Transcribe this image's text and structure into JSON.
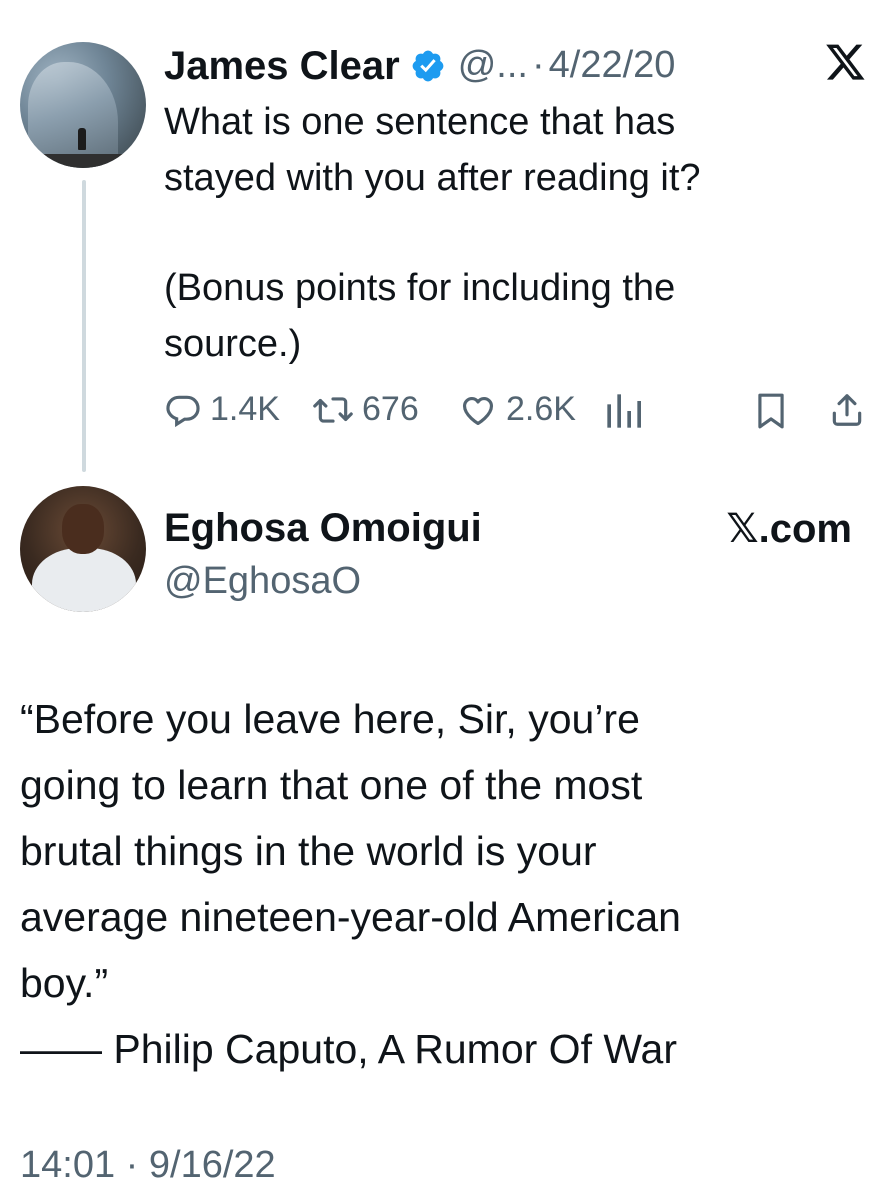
{
  "original_tweet": {
    "author_name": "James Clear",
    "handle_truncated": "@...",
    "separator": "·",
    "date": "4/22/20",
    "text_line1": "What is one sentence that has",
    "text_line2": "stayed with you after reading it?",
    "text_line3": "(Bonus points for including the",
    "text_line4": "source.)",
    "stats": {
      "replies": "1.4K",
      "retweets": "676",
      "likes": "2.6K"
    }
  },
  "reply_tweet": {
    "author_name": "Eghosa Omoigui",
    "handle": "@EghosaO",
    "source_label": "𝕏.com",
    "quote_lines": [
      "“Before you leave here, Sir, you’re",
      "going to learn that one of the most",
      "brutal things in the world is your",
      "average nineteen-year-old American",
      "boy.”",
      "—— Philip Caputo, A Rumor Of War"
    ],
    "time": "14:01",
    "separator": "·",
    "date": "9/16/22"
  },
  "icons": {
    "close": "x-logo-icon",
    "verified": "verified-badge-icon",
    "reply": "reply-icon",
    "retweet": "retweet-icon",
    "like": "heart-icon",
    "views": "views-icon",
    "bookmark": "bookmark-icon",
    "share": "share-icon"
  },
  "colors": {
    "text": "#0f1419",
    "muted": "#536471",
    "verified_blue": "#1d9bf0",
    "thread_line": "#cfd9de"
  }
}
